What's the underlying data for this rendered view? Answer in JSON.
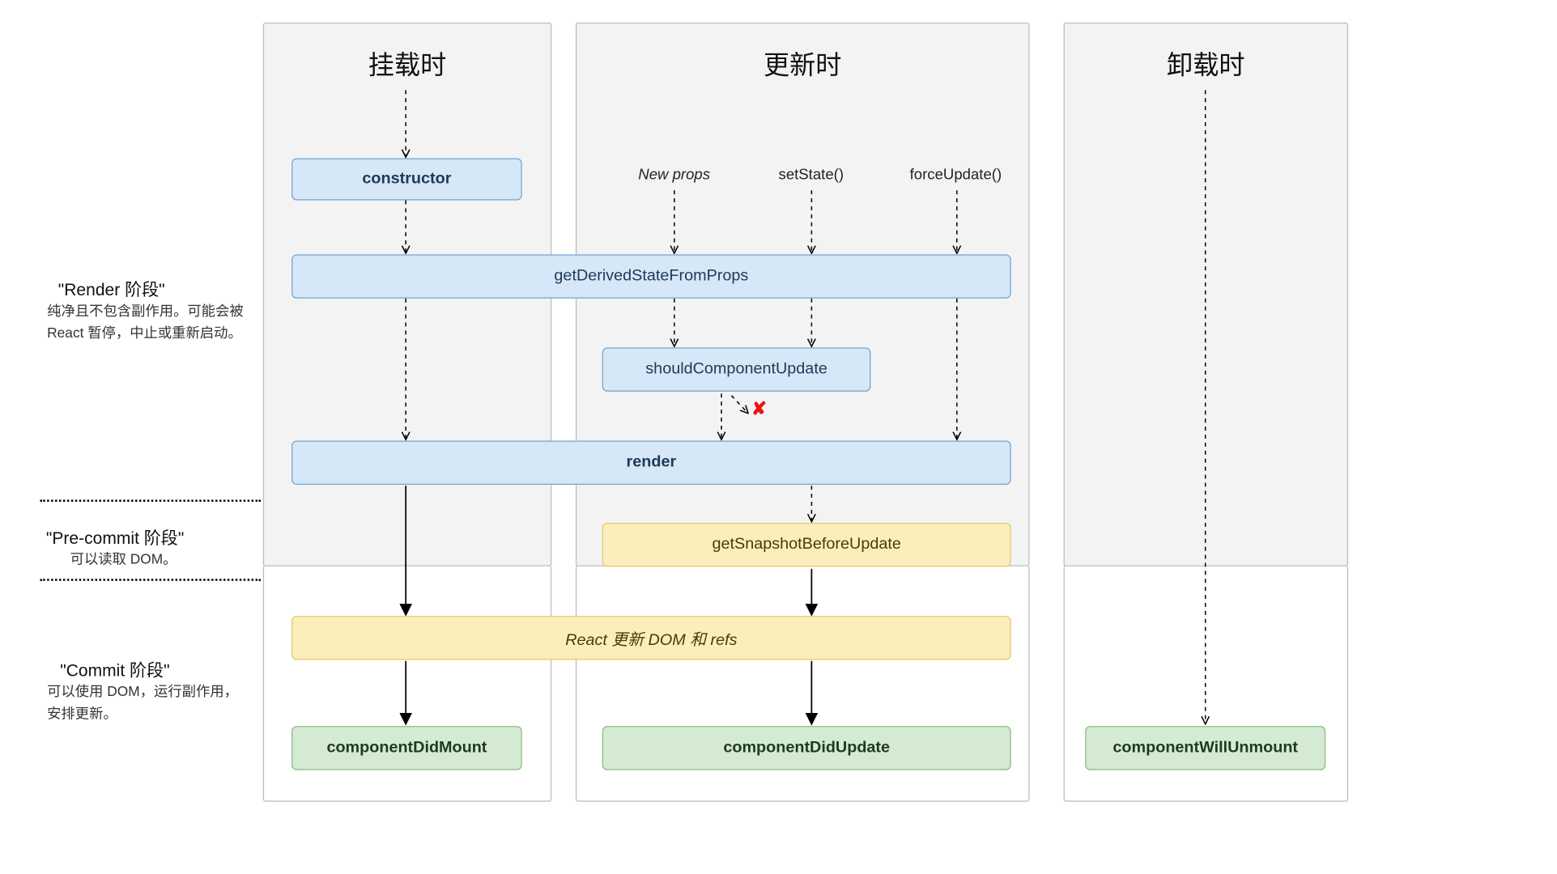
{
  "columns": {
    "mount": "挂载时",
    "update": "更新时",
    "unmount": "卸载时"
  },
  "phases": {
    "render": {
      "title": "\"Render 阶段\"",
      "desc": "纯净且不包含副作用。可能会被 React 暂停，中止或重新启动。"
    },
    "precommit": {
      "title": "\"Pre-commit 阶段\"",
      "desc": "可以读取 DOM。"
    },
    "commit": {
      "title": "\"Commit 阶段\"",
      "desc": "可以使用 DOM，运行副作用，安排更新。"
    }
  },
  "triggers": {
    "newprops": "New props",
    "setstate": "setState()",
    "forceupdate": "forceUpdate()"
  },
  "nodes": {
    "constructor": "constructor",
    "gdsfp": "getDerivedStateFromProps",
    "scu": "shouldComponentUpdate",
    "render": "render",
    "gsbu": "getSnapshotBeforeUpdate",
    "reactupdate": "React 更新 DOM 和 refs",
    "cdm": "componentDidMount",
    "cdu": "componentDidUpdate",
    "cwu": "componentWillUnmount"
  },
  "marks": {
    "cancel": "✘"
  }
}
